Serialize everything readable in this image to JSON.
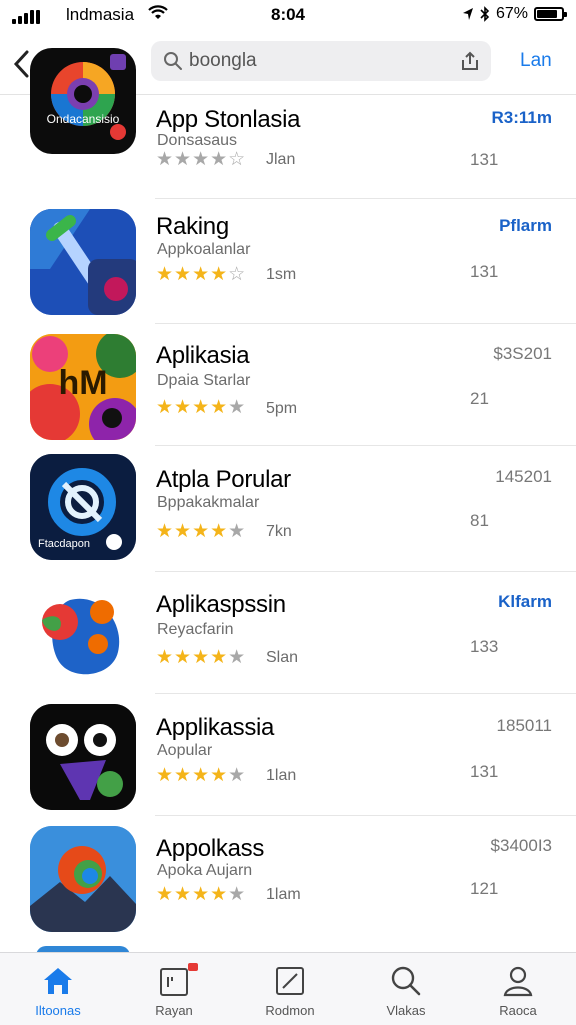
{
  "status": {
    "carrier": "lndmasia",
    "time": "8:04",
    "battery": "67%"
  },
  "nav": {
    "search_value": "boongla",
    "action_label": "Lan"
  },
  "apps": [
    {
      "title": "App Stonlasia",
      "subtitle": "Donsasaus",
      "stars": 4,
      "half": true,
      "rating_count": "Jlan",
      "price": "R3:11m",
      "price_accent": true,
      "size": "131",
      "icon_label": "Ondacansisio"
    },
    {
      "title": "Raking",
      "subtitle": "Appkoalanlar",
      "stars": 4,
      "half": false,
      "rating_count": "1sm",
      "price": "Pflarm",
      "price_accent": true,
      "size": "131",
      "icon_label": ""
    },
    {
      "title": "Aplikasia",
      "subtitle": "Dpaia Starlar",
      "stars": 4,
      "half": false,
      "rating_count": "5pm",
      "price": "$3S201",
      "price_accent": false,
      "size": "21",
      "icon_label": "hM"
    },
    {
      "title": "Atpla Porular",
      "subtitle": "Bppakakmalar",
      "stars": 4,
      "half": false,
      "rating_count": "7kn",
      "price": "145201",
      "price_accent": false,
      "size": "81",
      "icon_label": "Ftacdapon"
    },
    {
      "title": "Aplikaspssin",
      "subtitle": "Reyacfarin",
      "stars": 4,
      "half": false,
      "rating_count": "Slan",
      "price": "Klfarm",
      "price_accent": true,
      "size": "133",
      "icon_label": ""
    },
    {
      "title": "Applikassia",
      "subtitle": "Aopular",
      "stars": 4,
      "half": false,
      "rating_count": "1lan",
      "price": "185011",
      "price_accent": false,
      "size": "131",
      "icon_label": ""
    },
    {
      "title": "Appolkass",
      "subtitle": "Apoka Aujarn",
      "stars": 4,
      "half": false,
      "rating_count": "1lam",
      "price": "$3400I3",
      "price_accent": false,
      "size": "121",
      "icon_label": ""
    }
  ],
  "tabs": [
    {
      "label": "Iltoonas",
      "icon": "home-icon"
    },
    {
      "label": "Rayan",
      "icon": "calendar-icon"
    },
    {
      "label": "Rodmon",
      "icon": "edit-icon"
    },
    {
      "label": "Vlakas",
      "icon": "search-icon"
    },
    {
      "label": "Raoca",
      "icon": "person-icon"
    }
  ],
  "colors": {
    "accent": "#1a7bea",
    "star": "#f4b41a",
    "badge": "#e53935"
  }
}
